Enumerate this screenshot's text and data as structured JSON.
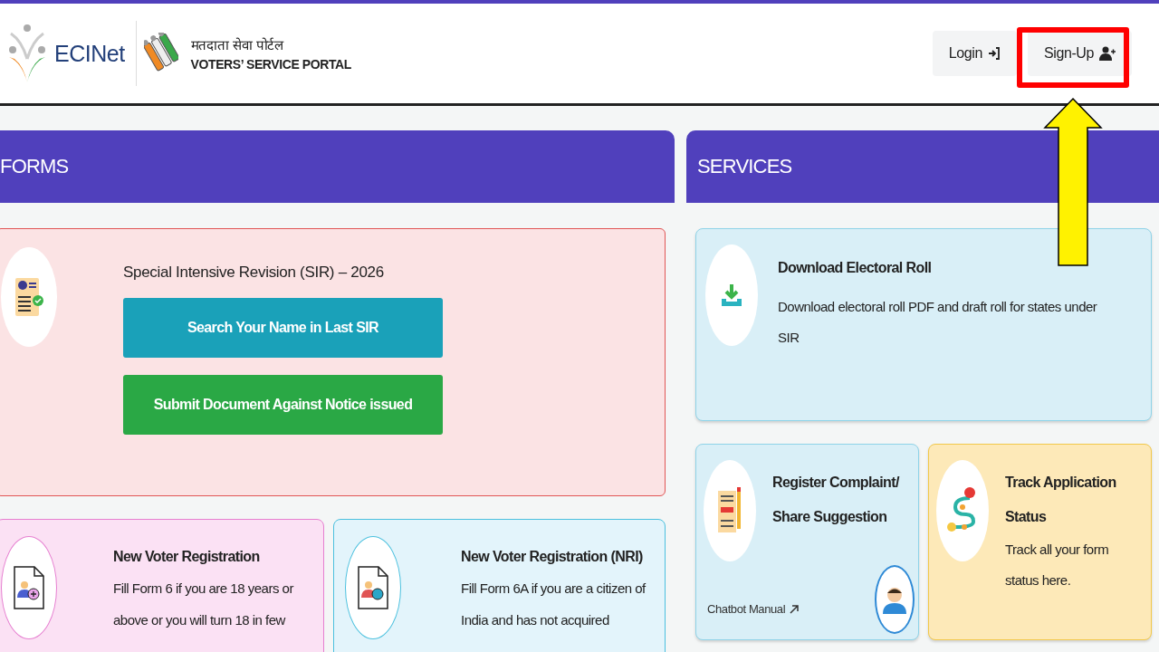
{
  "header": {
    "logo_text": "ECINet",
    "portal_title_hindi": "मतदाता सेवा पोर्टल",
    "portal_title": "VOTERS’ SERVICE PORTAL",
    "nav": [
      {
        "label": "Login",
        "kind": "login"
      },
      {
        "label": "Sign-Up",
        "kind": "signup"
      }
    ]
  },
  "forms": {
    "title": "FORMS",
    "sir_card": {
      "title": "Special Intensive Revision (SIR) – 2026",
      "buttons": [
        {
          "label": "Search Your Name in Last SIR",
          "kind": "primary"
        },
        {
          "label": "Submit Document Against Notice issued",
          "kind": "success"
        }
      ]
    },
    "cards": [
      {
        "title": "New Voter Registration",
        "description": "Fill Form 6 if you are 18 years or above or you will turn 18 in few",
        "kind": "person-plus",
        "color": "#fbe1f4"
      },
      {
        "title": "New Voter Registration (NRI)",
        "description": "Fill Form 6A if you are a citizen of India and has not acquired",
        "kind": "person-globe",
        "color": "#e3f4fb"
      }
    ]
  },
  "services": {
    "title": "SERVICES",
    "cards": [
      {
        "title": "Download Electoral Roll",
        "description": "Download electoral roll PDF and draft roll for states under SIR",
        "kind": "download",
        "color": "#d9eff7"
      },
      {
        "title": "Register Complaint/ Share Suggestion",
        "link": "Chatbot Manual",
        "kind": "complaint",
        "color": "#d9eff7"
      },
      {
        "title": "Track Application Status",
        "description": "Track all your form status here.",
        "kind": "track",
        "color": "#fde9b8"
      }
    ]
  }
}
